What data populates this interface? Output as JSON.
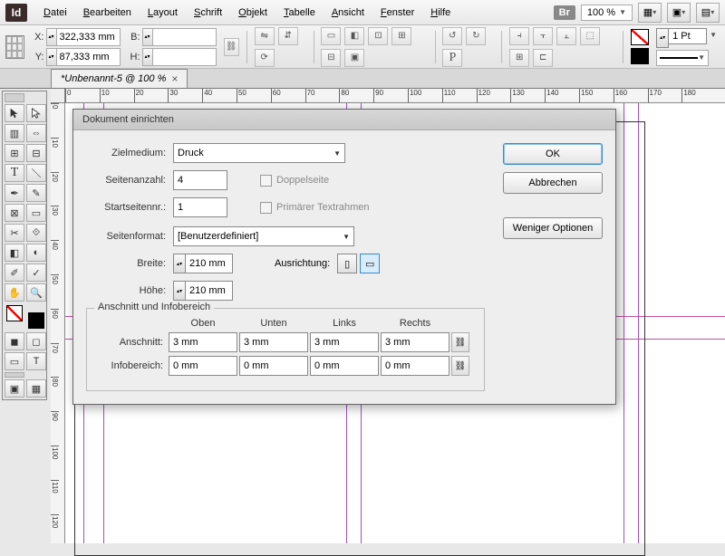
{
  "app_logo": "Id",
  "menu": [
    "Datei",
    "Bearbeiten",
    "Layout",
    "Schrift",
    "Objekt",
    "Tabelle",
    "Ansicht",
    "Fenster",
    "Hilfe"
  ],
  "br_label": "Br",
  "zoom": "100 %",
  "coords": {
    "x_label": "X:",
    "y_label": "Y:",
    "x": "322,333 mm",
    "y": "87,333 mm",
    "w_label": "B:",
    "h_label": "H:",
    "w": "",
    "h": ""
  },
  "stroke": {
    "weight": "1 Pt"
  },
  "doc_tab": "*Unbenannt-5 @ 100 %",
  "ruler_ticks_h": [
    "0",
    "10",
    "20",
    "30",
    "40",
    "50",
    "60",
    "70",
    "80",
    "90",
    "100",
    "110",
    "120",
    "130",
    "140",
    "150",
    "160",
    "170",
    "180"
  ],
  "ruler_ticks_v": [
    "0",
    "10",
    "20",
    "30",
    "40",
    "50",
    "60",
    "70",
    "80",
    "90",
    "100",
    "110",
    "120"
  ],
  "dialog": {
    "title": "Dokument einrichten",
    "zielmedium_label": "Zielmedium:",
    "zielmedium": "Druck",
    "seitenanzahl_label": "Seitenanzahl:",
    "seitenanzahl": "4",
    "startseite_label": "Startseitennr.:",
    "startseite": "1",
    "doppelseite": "Doppelseite",
    "primaer": "Primärer Textrahmen",
    "seitenformat_label": "Seitenformat:",
    "seitenformat": "[Benutzerdefiniert]",
    "breite_label": "Breite:",
    "breite": "210 mm",
    "hoehe_label": "Höhe:",
    "hoehe": "210 mm",
    "ausrichtung_label": "Ausrichtung:",
    "fieldset_title": "Anschnitt und Infobereich",
    "cols": {
      "oben": "Oben",
      "unten": "Unten",
      "links": "Links",
      "rechts": "Rechts"
    },
    "anschnitt_label": "Anschnitt:",
    "anschnitt": {
      "oben": "3 mm",
      "unten": "3 mm",
      "links": "3 mm",
      "rechts": "3 mm"
    },
    "infobereich_label": "Infobereich:",
    "infobereich": {
      "oben": "0 mm",
      "unten": "0 mm",
      "links": "0 mm",
      "rechts": "0 mm"
    },
    "ok": "OK",
    "cancel": "Abbrechen",
    "less": "Weniger Optionen"
  }
}
